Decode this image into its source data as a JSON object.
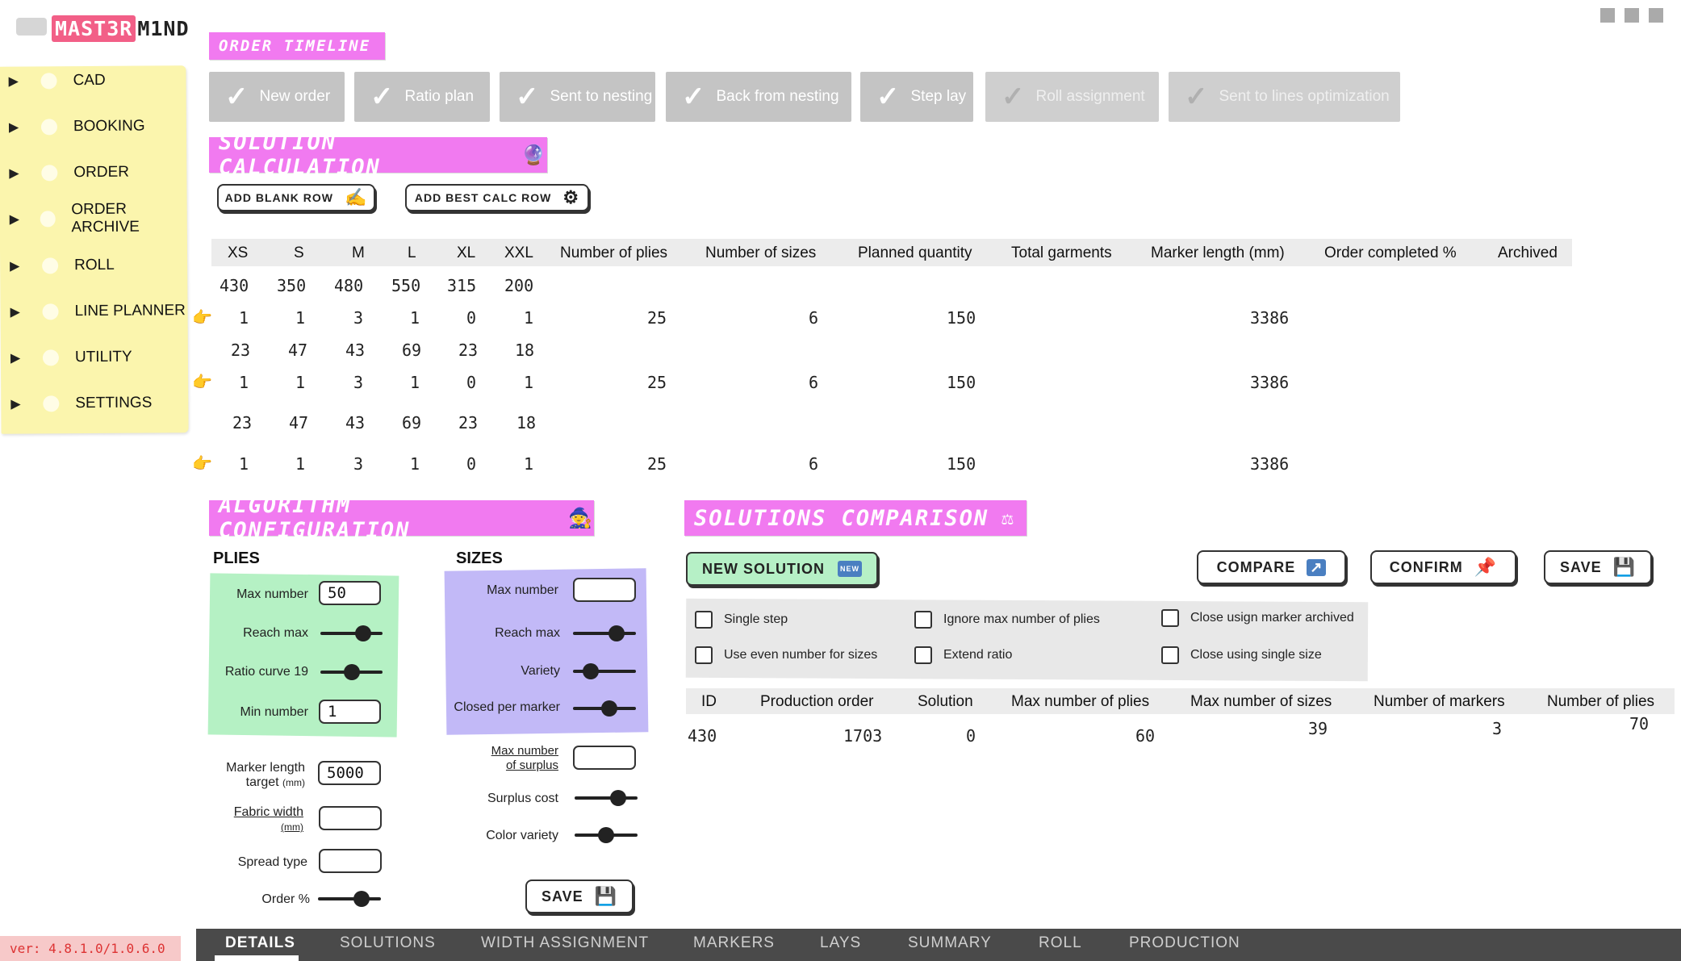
{
  "logo": {
    "part1": "MAST3R",
    "part2": "M1ND"
  },
  "sidebar": {
    "items": [
      {
        "label": "CAD"
      },
      {
        "label": "BOOKING"
      },
      {
        "label": "ORDER"
      },
      {
        "label": "ORDER ARCHIVE"
      },
      {
        "label": "ROLL"
      },
      {
        "label": "LINE PLANNER"
      },
      {
        "label": "UTILITY"
      },
      {
        "label": "SETTINGS"
      }
    ]
  },
  "timeline": {
    "title": "ORDER TIMELINE",
    "steps": [
      {
        "label": "New order",
        "status": "done"
      },
      {
        "label": "Ratio plan",
        "status": "done"
      },
      {
        "label": "Sent to nesting",
        "status": "done"
      },
      {
        "label": "Back from nesting",
        "status": "done"
      },
      {
        "label": "Step lay",
        "status": "done"
      },
      {
        "label": "Roll assignment",
        "status": "pending"
      },
      {
        "label": "Sent to lines optimization",
        "status": "pending"
      }
    ]
  },
  "solution_calc": {
    "title": "SOLUTION CALCULATION",
    "add_blank_label": "ADD BLANK ROW",
    "add_best_label": "ADD BEST CALC ROW",
    "columns": [
      "XS",
      "S",
      "M",
      "L",
      "XL",
      "XXL",
      "Number of plies",
      "Number of sizes",
      "Planned quantity",
      "Total garments",
      "Marker length (mm)",
      "Order completed %",
      "Archived"
    ],
    "quantities": [
      "430",
      "350",
      "480",
      "550",
      "315",
      "200"
    ],
    "rows": [
      {
        "sizes": [
          "1",
          "1",
          "3",
          "1",
          "0",
          "1"
        ],
        "plies": "25",
        "num_sizes": "6",
        "planned": "150",
        "marker_length": "3386",
        "remaining": [
          "23",
          "47",
          "43",
          "69",
          "23",
          "18"
        ]
      },
      {
        "sizes": [
          "1",
          "1",
          "3",
          "1",
          "0",
          "1"
        ],
        "plies": "25",
        "num_sizes": "6",
        "planned": "150",
        "marker_length": "3386",
        "remaining": [
          "23",
          "47",
          "43",
          "69",
          "23",
          "18"
        ]
      },
      {
        "sizes": [
          "1",
          "1",
          "3",
          "1",
          "0",
          "1"
        ],
        "plies": "25",
        "num_sizes": "6",
        "planned": "150",
        "marker_length": "3386"
      }
    ]
  },
  "algo": {
    "title": "ALGORITHM CONFIGURATION",
    "plies_heading": "PLIES",
    "sizes_heading": "SIZES",
    "plies": {
      "max_number_label": "Max number",
      "max_number_value": "50",
      "reach_max_label": "Reach max",
      "reach_max_level": 0.75,
      "ratio_curve_label": "Ratio curve 19",
      "ratio_curve_level": 0.5,
      "min_number_label": "Min number",
      "min_number_value": "1"
    },
    "marker_length_label": "Marker length",
    "marker_length_label2": "target",
    "marker_length_unit": "(mm)",
    "marker_length_value": "5000",
    "fabric_width_label": "Fabric width",
    "fabric_width_unit": "(mm)",
    "fabric_width_value": "",
    "spread_type_label": "Spread type",
    "spread_type_value": "",
    "order_pct_label": "Order %",
    "order_pct_level": 0.75,
    "sizes": {
      "max_number_label": "Max number",
      "max_number_value": "",
      "reach_max_label": "Reach max",
      "reach_max_level": 0.75,
      "variety_label": "Variety",
      "variety_level": 0.2,
      "closed_label": "Closed per marker",
      "closed_level": 0.6
    },
    "max_surplus_label": "Max number",
    "max_surplus_label2": "of surplus",
    "max_surplus_value": "",
    "surplus_cost_label": "Surplus cost",
    "surplus_cost_level": 0.75,
    "color_variety_label": "Color variety",
    "color_variety_level": 0.5,
    "save_label": "SAVE"
  },
  "comparison": {
    "title": "SOLUTIONS COMPARISON",
    "new_solution_label": "NEW SOLUTION",
    "new_badge": "NEW",
    "compare_label": "COMPARE",
    "confirm_label": "CONFIRM",
    "save_label": "SAVE",
    "options": [
      {
        "label": "Single step",
        "checked": false
      },
      {
        "label": "Use even number for sizes",
        "checked": false
      },
      {
        "label": "Ignore max number of plies",
        "checked": false
      },
      {
        "label": "Extend ratio",
        "checked": false
      },
      {
        "label": "Close usign marker archived",
        "checked": false
      },
      {
        "label": "Close using single size",
        "checked": false
      }
    ],
    "columns": [
      "ID",
      "Production order",
      "Solution",
      "Max number of plies",
      "Max number of sizes",
      "Number of markers",
      "Number of plies"
    ],
    "rows": [
      {
        "id": "430",
        "production_order": "1703",
        "solution": "0",
        "max_plies": "60",
        "max_sizes": "39",
        "markers": "3",
        "plies": "70"
      }
    ]
  },
  "version": "ver: 4.8.1.0/1.0.6.0",
  "tabs": [
    {
      "label": "DETAILS",
      "active": true
    },
    {
      "label": "SOLUTIONS"
    },
    {
      "label": "WIDTH ASSIGNMENT"
    },
    {
      "label": "MARKERS"
    },
    {
      "label": "LAYS"
    },
    {
      "label": "SUMMARY"
    },
    {
      "label": "ROLL"
    },
    {
      "label": "PRODUCTION"
    }
  ],
  "colors": {
    "accent_pink": "#f17af0",
    "logo_pink": "#f25f87",
    "sidebar": "#fbf5ad",
    "plies_panel": "#b5f1c4",
    "sizes_panel": "#c2b9f7"
  }
}
